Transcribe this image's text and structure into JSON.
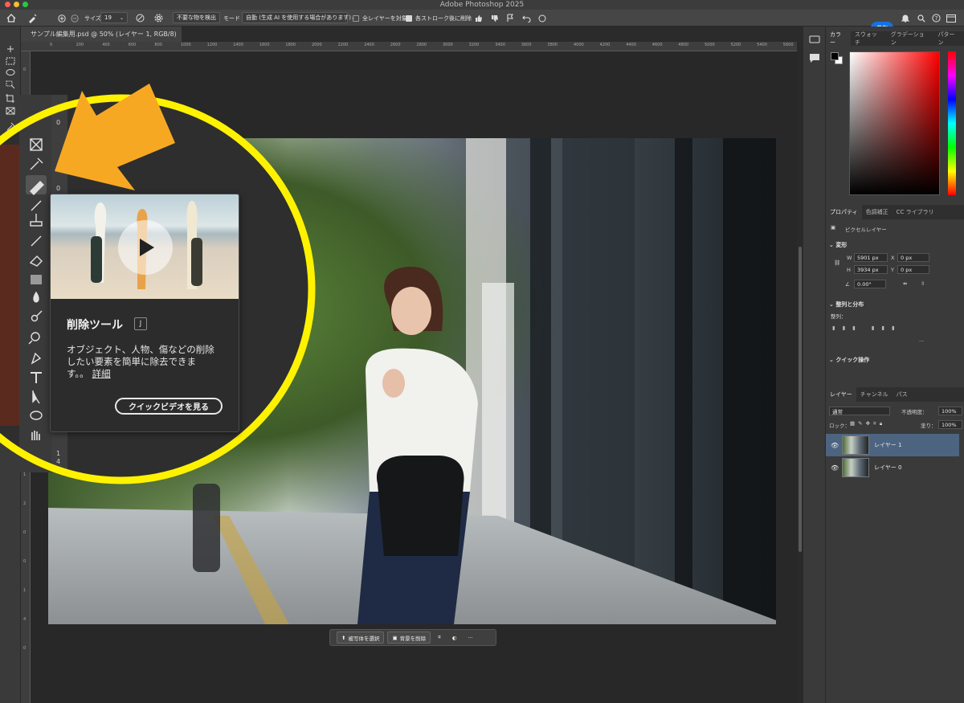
{
  "app": {
    "window_title": "Adobe Photoshop 2025"
  },
  "colors": {
    "accent": "#1473e6",
    "highlight_circle": "#fff200",
    "arrow": "#f7a823",
    "selected_layer": "#4c6480"
  },
  "options_bar": {
    "size_label": "サイズ",
    "size_value": "19",
    "detect_button": "不要な物を検出",
    "mode_label": "モード",
    "mode_value": "自動 (生成 AI を使用する場合があります)",
    "all_layers_label": "全レイヤーを対象",
    "all_layers_checked": false,
    "delete_after_stroke_label": "各ストローク後に削除",
    "delete_after_stroke_checked": true,
    "share_label": "共有"
  },
  "document": {
    "tab_title": "サンプル編集用.psd @ 50% (レイヤー 1, RGB/8)"
  },
  "rulers": {
    "horizontal": [
      "0",
      "200",
      "400",
      "600",
      "800",
      "1000",
      "1200",
      "1400",
      "1600",
      "1800",
      "2000",
      "2200",
      "2400",
      "2600",
      "2800",
      "3000",
      "3200",
      "3400",
      "3600",
      "3800",
      "4000",
      "4200",
      "4400",
      "4600",
      "4800",
      "5000",
      "5200",
      "5400",
      "5600",
      "5800",
      "600"
    ],
    "vertical": [
      "0",
      "2",
      "0",
      "4",
      "0",
      "0",
      "6",
      "0",
      "0",
      "8",
      "0",
      "0",
      "1",
      "0",
      "1",
      "2",
      "0",
      "0",
      "1",
      "4",
      "0"
    ]
  },
  "tooltip": {
    "title": "削除ツール",
    "shortcut": "J",
    "description": "オブジェクト、人物、傷などの削除したい要素を簡単に除去できます。。",
    "link_label": "詳細",
    "video_button": "クイックビデオを見る"
  },
  "context_bar": {
    "select_subject": "被写体を選択",
    "remove_background": "背景を削除",
    "more": "···"
  },
  "panels": {
    "color_tabs": [
      "カラー",
      "スウォッチ",
      "グラデーション",
      "パターン"
    ],
    "properties_tabs": [
      "プロパティ",
      "色調補正",
      "CC ライブラリ"
    ],
    "pixel_layer_label": "ピクセルレイヤー",
    "transform": {
      "title": "変形",
      "w_label": "W",
      "w_value": "5901 px",
      "h_label": "H",
      "h_value": "3934 px",
      "x_label": "X",
      "x_value": "0 px",
      "y_label": "Y",
      "y_value": "0 px",
      "angle_value": "0.00°"
    },
    "align_title": "整列と分布",
    "align_label": "整列：",
    "quick_actions_title": "クイック操作",
    "layers_tabs": [
      "レイヤー",
      "チャンネル",
      "パス"
    ],
    "blend_mode": "通常",
    "opacity_label": "不透明度：",
    "opacity_value": "100%",
    "lock_label": "ロック：",
    "fill_label": "塗り：",
    "fill_value": "100%",
    "layers": [
      {
        "name": "レイヤー 1",
        "selected": true
      },
      {
        "name": "レイヤー 0",
        "selected": false
      }
    ]
  }
}
